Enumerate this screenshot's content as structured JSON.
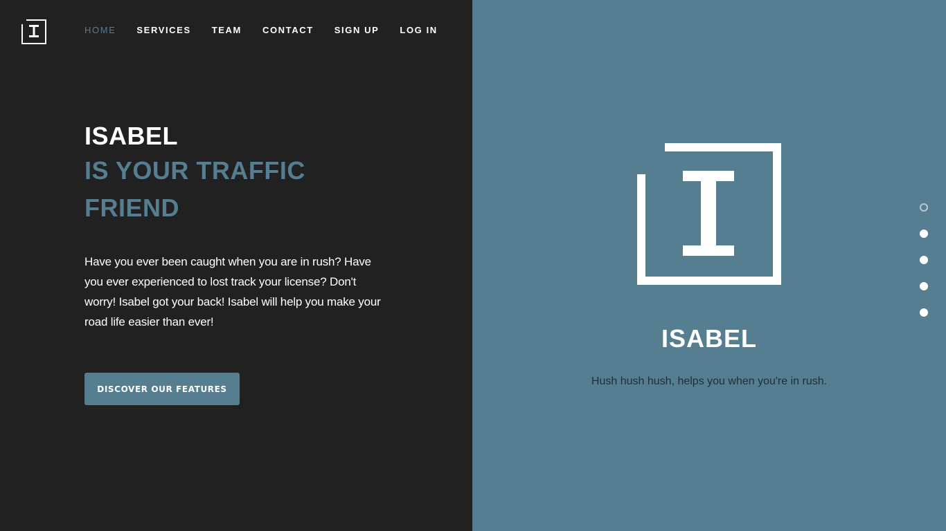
{
  "nav": {
    "items": [
      {
        "label": "HOME",
        "active": true
      },
      {
        "label": "SERVICES",
        "active": false
      },
      {
        "label": "TEAM",
        "active": false
      },
      {
        "label": "CONTACT",
        "active": false
      },
      {
        "label": "SIGN UP",
        "active": false
      },
      {
        "label": "LOG IN",
        "active": false
      }
    ],
    "logo_icon": "isabel-logo-icon"
  },
  "hero": {
    "title": "ISABEL",
    "subtitle": "IS YOUR TRAFFIC FRIEND",
    "description": "Have you ever been caught when you are in rush? Have you ever experienced to lost track your license? Don't worry! Isabel got your back! Isabel will help you make your road life easier than ever!",
    "cta_label": "DISCOVER OUR FEATURES"
  },
  "showcase": {
    "brand_name": "ISABEL",
    "tagline": "Hush hush hush, helps you when you're in rush.",
    "logo_icon": "isabel-logo-icon"
  },
  "pager": {
    "count": 5,
    "active_index": 0
  },
  "colors": {
    "dark_background": "#212121",
    "accent": "#557e91",
    "text_light": "#ffffff"
  }
}
